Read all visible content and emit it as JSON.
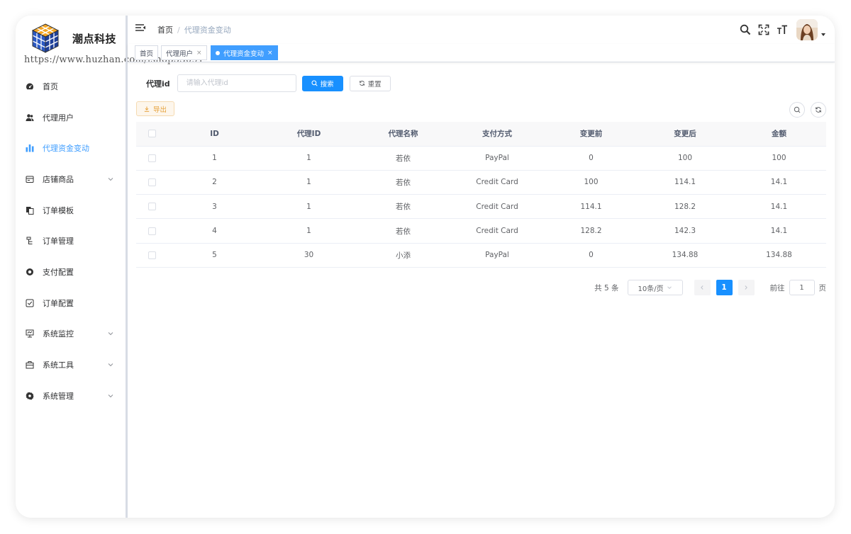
{
  "app": {
    "title": "潮点科技",
    "watermark": "https://www.huzhan.com/ishop53091"
  },
  "sidebar": {
    "items": [
      {
        "label": "首页",
        "icon": "dashboard-icon",
        "active": false,
        "has_children": false
      },
      {
        "label": "代理用户",
        "icon": "users-icon",
        "active": false,
        "has_children": false
      },
      {
        "label": "代理资金变动",
        "icon": "bar-chart-icon",
        "active": true,
        "has_children": false
      },
      {
        "label": "店铺商品",
        "icon": "shop-icon",
        "active": false,
        "has_children": true
      },
      {
        "label": "订单模板",
        "icon": "template-icon",
        "active": false,
        "has_children": false
      },
      {
        "label": "订单管理",
        "icon": "order-icon",
        "active": false,
        "has_children": false
      },
      {
        "label": "支付配置",
        "icon": "payment-icon",
        "active": false,
        "has_children": false
      },
      {
        "label": "订单配置",
        "icon": "checkbox-icon",
        "active": false,
        "has_children": false
      },
      {
        "label": "系统监控",
        "icon": "monitor-icon",
        "active": false,
        "has_children": true
      },
      {
        "label": "系统工具",
        "icon": "toolbox-icon",
        "active": false,
        "has_children": true
      },
      {
        "label": "系统管理",
        "icon": "gear-icon",
        "active": false,
        "has_children": true
      }
    ]
  },
  "header": {
    "breadcrumb": {
      "home": "首页",
      "separator": "/",
      "current": "代理资金变动"
    }
  },
  "tags": [
    {
      "label": "首页",
      "closable": false,
      "active": false
    },
    {
      "label": "代理用户",
      "closable": true,
      "active": false
    },
    {
      "label": "代理资金变动",
      "closable": true,
      "active": true
    }
  ],
  "tag_close_glyph": "×",
  "filter": {
    "label": "代理id",
    "input_value": "",
    "placeholder": "请输入代理id",
    "search_label": "搜索",
    "reset_label": "重置"
  },
  "toolbar": {
    "export_label": "导出"
  },
  "table": {
    "columns": [
      "ID",
      "代理ID",
      "代理名称",
      "支付方式",
      "变更前",
      "变更后",
      "金额"
    ],
    "rows": [
      [
        "1",
        "1",
        "若依",
        "PayPal",
        "0",
        "100",
        "100"
      ],
      [
        "2",
        "1",
        "若依",
        "Credit Card",
        "100",
        "114.1",
        "14.1"
      ],
      [
        "3",
        "1",
        "若依",
        "Credit Card",
        "114.1",
        "128.2",
        "14.1"
      ],
      [
        "4",
        "1",
        "若依",
        "Credit Card",
        "128.2",
        "142.3",
        "14.1"
      ],
      [
        "5",
        "30",
        "小添",
        "PayPal",
        "0",
        "134.88",
        "134.88"
      ]
    ]
  },
  "pagination": {
    "total_text": "共 5 条",
    "page_size": "10条/页",
    "current_page": "1",
    "goto_prefix": "前往",
    "goto_value": "1",
    "goto_suffix": "页"
  },
  "colors": {
    "primary": "#1890ff",
    "active_menu": "#409eff",
    "warning": "#e6a23c"
  }
}
